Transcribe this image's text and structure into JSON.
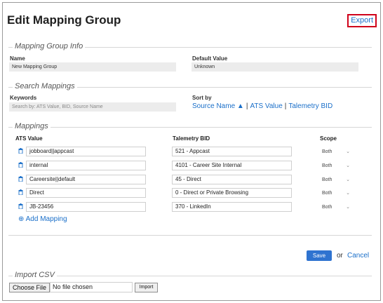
{
  "header": {
    "title": "Edit Mapping Group",
    "export_label": "Export"
  },
  "group_info": {
    "legend": "Mapping Group Info",
    "name_label": "Name",
    "name_value": "New Mapping Group",
    "default_label": "Default Value",
    "default_value": "Unknown"
  },
  "search": {
    "legend": "Search Mappings",
    "keywords_label": "Keywords",
    "keywords_placeholder": "Search by: ATS Value, BID, Source Name",
    "sortby_label": "Sort by",
    "sort_source": "Source Name ▲",
    "sort_ats": "ATS Value",
    "sort_bid": "Talemetry BID",
    "sep": "|"
  },
  "mappings": {
    "legend": "Mappings",
    "col_ats": "ATS Value",
    "col_bid": "Talemetry BID",
    "col_scope": "Scope",
    "rows": [
      {
        "ats": "jobboard||appcast",
        "bid": "521 - Appcast",
        "scope": "Both"
      },
      {
        "ats": "internal",
        "bid": "4101 - Career Site Internal",
        "scope": "Both"
      },
      {
        "ats": "Careersite||default",
        "bid": "45 - Direct",
        "scope": "Both"
      },
      {
        "ats": "Direct",
        "bid": "0 - Direct or Private Browsing",
        "scope": "Both"
      },
      {
        "ats": "JB-23456",
        "bid": "370 - LinkedIn",
        "scope": "Both"
      }
    ],
    "add_label": "Add Mapping"
  },
  "actions": {
    "save_label": "Save",
    "or_text": "or",
    "cancel_label": "Cancel"
  },
  "import": {
    "legend": "Import CSV",
    "choose_label": "Choose File",
    "no_file_text": "No file chosen",
    "import_label": "Import"
  },
  "colors": {
    "link": "#1a6fc9",
    "save_bg": "#2f73d0",
    "export_border": "#d0021b"
  },
  "icons": {
    "delete": "trash-icon",
    "add": "plus-circle-icon",
    "scope_dropdown": "chevron-down-icon",
    "sort": "triangle-up-icon"
  }
}
